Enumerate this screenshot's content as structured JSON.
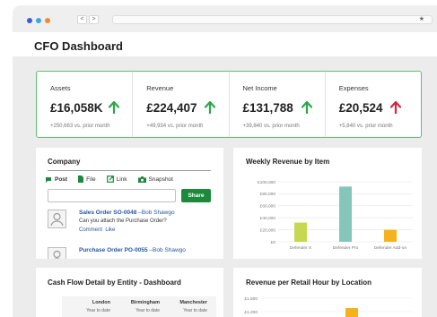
{
  "window": {
    "dot_colors": [
      "#3b5ed6",
      "#3aa8e6",
      "#f08c2e"
    ],
    "back_glyph": "<",
    "forward_glyph": ">",
    "star_glyph": "★"
  },
  "page": {
    "title": "CFO Dashboard"
  },
  "kpis": [
    {
      "label": "Assets",
      "value": "£16,058K",
      "sub": "+250,663 vs. prior month",
      "direction": "up",
      "color": "#2aa84a"
    },
    {
      "label": "Revenue",
      "value": "£224,407",
      "sub": "+49,934 vs. prior month",
      "direction": "up",
      "color": "#2aa84a"
    },
    {
      "label": "Net Income",
      "value": "£131,788",
      "sub": "+39,840 vs. prior month",
      "direction": "up",
      "color": "#2aa84a"
    },
    {
      "label": "Expenses",
      "value": "£20,524",
      "sub": "+5,840 vs. prior month",
      "direction": "up",
      "color": "#d3273e"
    }
  ],
  "company": {
    "title": "Company",
    "tabs": [
      {
        "label": "Post",
        "icon": "chat-icon"
      },
      {
        "label": "File",
        "icon": "file-icon"
      },
      {
        "label": "Link",
        "icon": "link-icon"
      },
      {
        "label": "Snapshot",
        "icon": "camera-icon"
      }
    ],
    "share_label": "Share",
    "feed": [
      {
        "title": "Sales Order SO-0048",
        "author": " –Bob Shawgo",
        "body": "Can you attach the Purchase Order?",
        "comment": "Comment",
        "like": "Like"
      },
      {
        "title": "Purchase Order PO-0055",
        "author": " –Bob Shawgo"
      }
    ]
  },
  "weekly_revenue": {
    "title": "Weekly Revenue by Item",
    "chart_data": {
      "type": "bar",
      "categories": [
        "Defender X",
        "Defender Pro",
        "Defender Add-on"
      ],
      "values": [
        32000,
        92000,
        20000
      ],
      "colors": [
        "#c5d84f",
        "#84c7ba",
        "#f6b21c"
      ],
      "ylim": [
        0,
        100000
      ],
      "yticks": [
        "£100,000",
        "£80,000",
        "£60,000",
        "£40,000",
        "£20,000",
        "£0"
      ]
    }
  },
  "cash_flow": {
    "title": "Cash Flow Detail by Entity - Dashboard",
    "columns": [
      {
        "header": "London",
        "sub": "Year to date"
      },
      {
        "header": "Birmingham",
        "sub": "Year to date"
      },
      {
        "header": "Manchester",
        "sub": "Year to date"
      }
    ]
  },
  "retail": {
    "title": "Revenue per Retail Hour by Location",
    "chart_data": {
      "type": "bar",
      "yticks": [
        "£1,500",
        "£1,200"
      ],
      "bar_color": "#f6b21c"
    }
  }
}
